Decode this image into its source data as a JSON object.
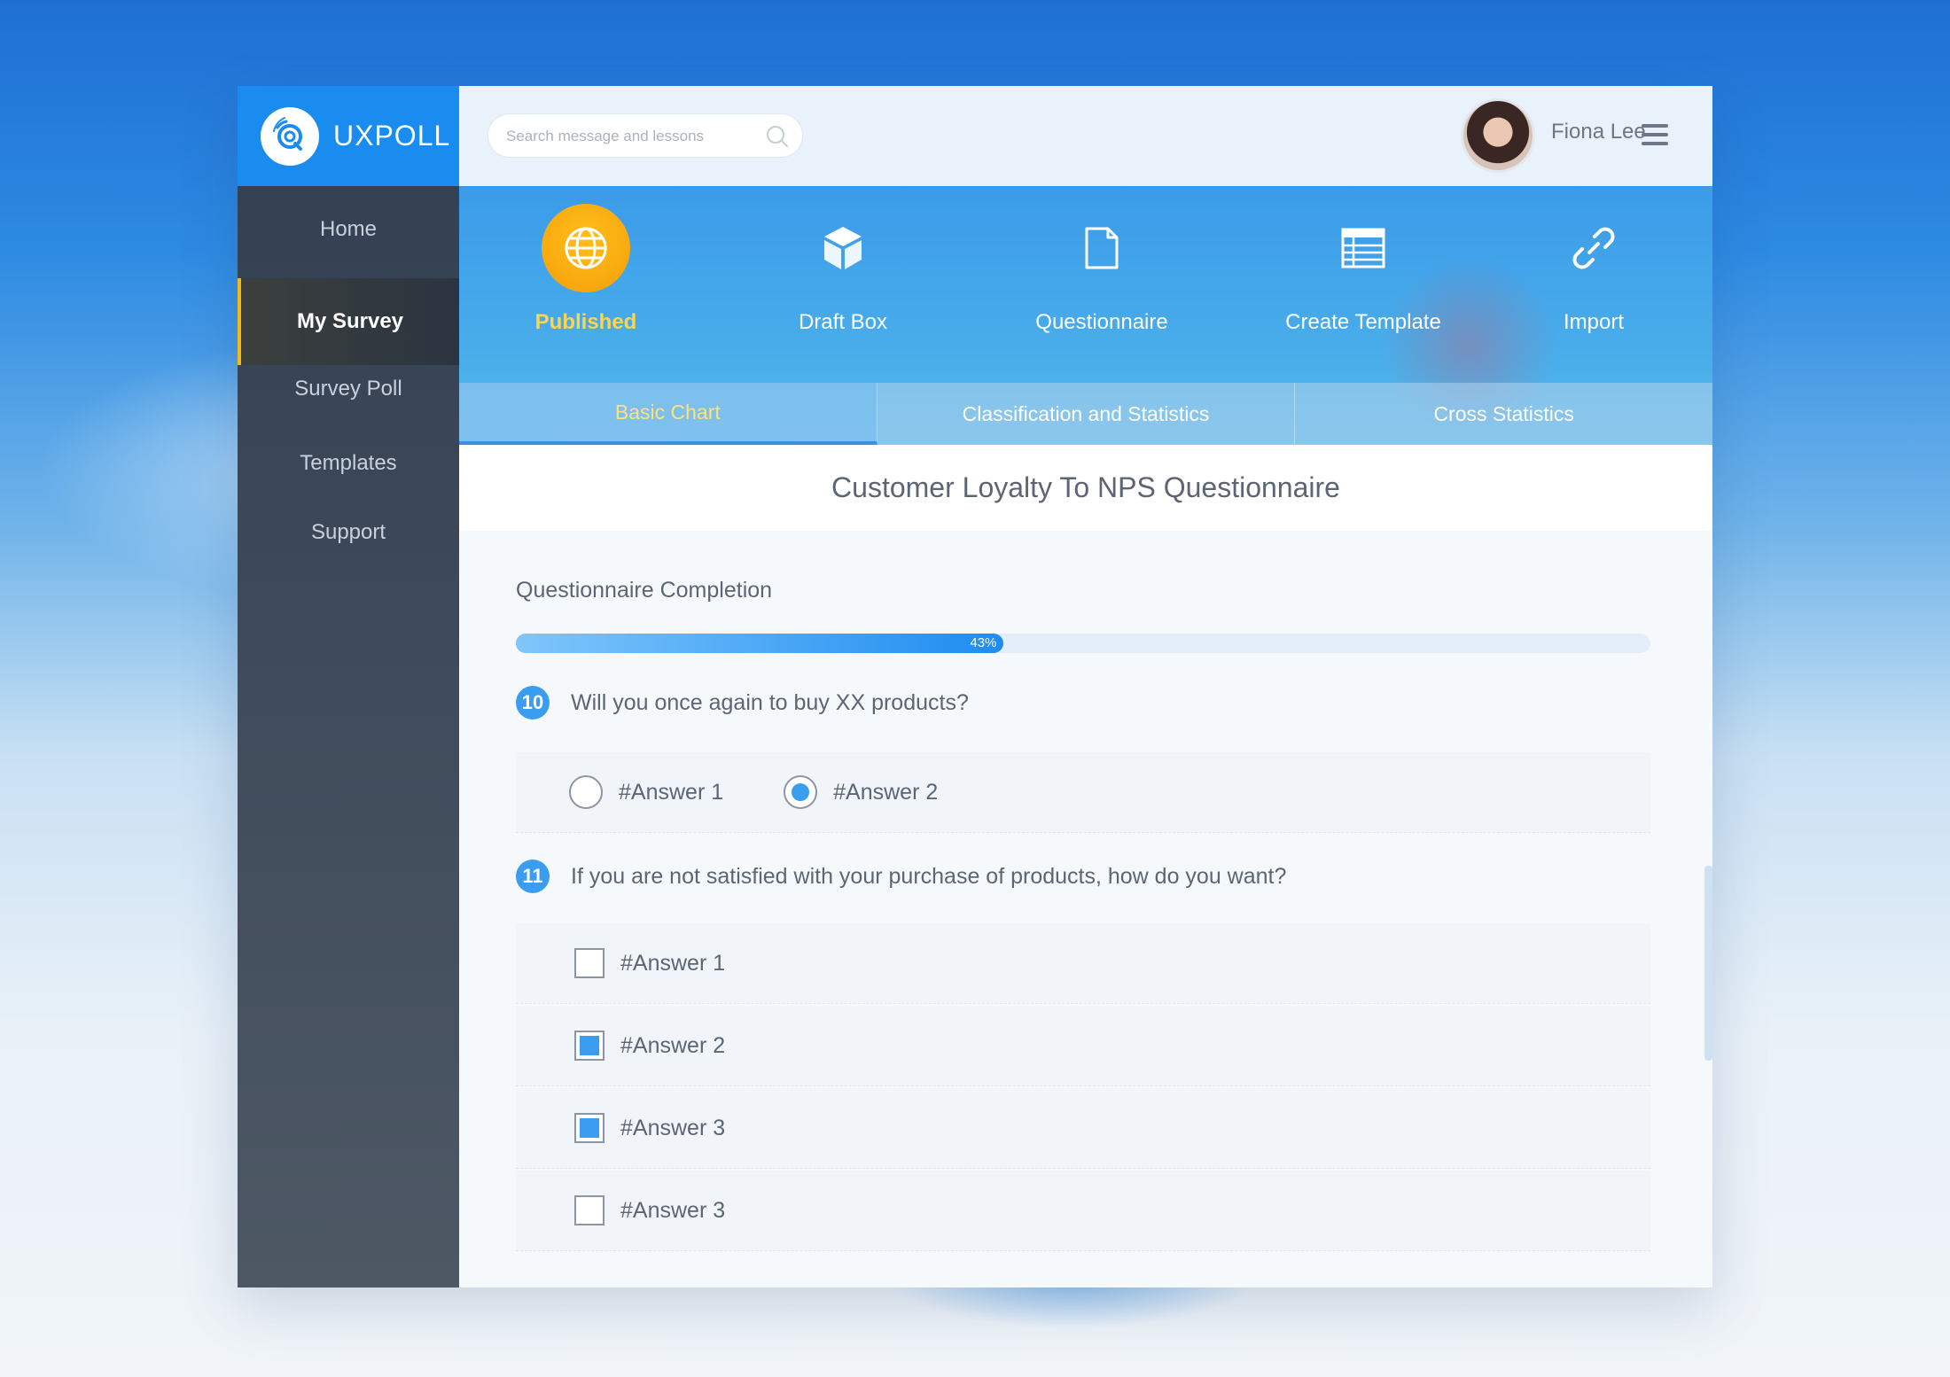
{
  "app": {
    "brand": "UXPOLL"
  },
  "sidebar": {
    "items": [
      {
        "label": "Home"
      },
      {
        "label": "My Survey"
      },
      {
        "label": "Survey Poll"
      },
      {
        "label": "Templates"
      },
      {
        "label": "Support"
      }
    ],
    "active_index": 1
  },
  "header": {
    "search_placeholder": "Search message and lessons",
    "user_name": "Fiona Lee"
  },
  "toolbar": {
    "items": [
      {
        "label": "Published",
        "icon": "globe-icon"
      },
      {
        "label": "Draft Box",
        "icon": "cube-icon"
      },
      {
        "label": "Questionnaire",
        "icon": "document-icon"
      },
      {
        "label": "Create Template",
        "icon": "table-icon"
      },
      {
        "label": "Import",
        "icon": "link-icon"
      }
    ],
    "active_index": 0
  },
  "tabs": {
    "items": [
      {
        "label": "Basic Chart"
      },
      {
        "label": "Classification and Statistics"
      },
      {
        "label": "Cross Statistics"
      }
    ],
    "active_index": 0
  },
  "survey": {
    "title": "Customer Loyalty To NPS Questionnaire",
    "completion_label": "Questionnaire Completion",
    "completion_percent": 43,
    "completion_text": "43%",
    "questions": [
      {
        "number": "10",
        "text": "Will you once again to buy XX products?",
        "type": "radio",
        "answers": [
          {
            "label": "#Answer 1",
            "selected": false
          },
          {
            "label": "#Answer 2",
            "selected": true
          }
        ]
      },
      {
        "number": "11",
        "text": "If you are not satisfied with your purchase of products, how do you want?",
        "type": "checkbox",
        "answers": [
          {
            "label": "#Answer 1",
            "selected": false
          },
          {
            "label": "#Answer 2",
            "selected": true
          },
          {
            "label": "#Answer 3",
            "selected": true
          },
          {
            "label": "#Answer 3",
            "selected": false
          }
        ]
      }
    ]
  },
  "colors": {
    "brand_blue": "#1a8cf0",
    "accent_yellow": "#ffd54a",
    "sidebar_active_bar": "#f3b81c",
    "selected_blue": "#3a9df0"
  }
}
